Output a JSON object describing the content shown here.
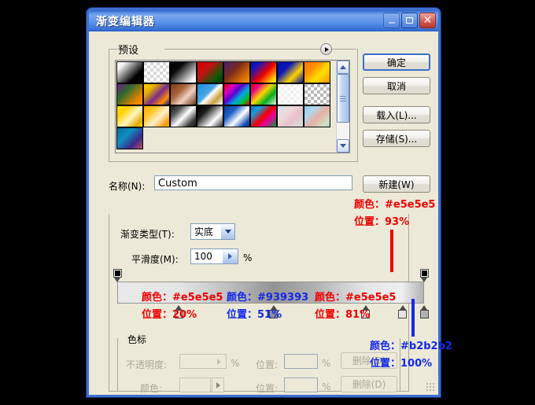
{
  "window": {
    "title": "渐变编辑器",
    "controls": {
      "minimize": "minimize",
      "maximize": "maximize",
      "close": "close"
    }
  },
  "presets": {
    "label": "预设",
    "menu_icon": "play-arrow-icon",
    "swatches": [
      [
        "linear-gradient(135deg,#ffffff 0%,#f2f2f2 18%,#000000 72%,#000000 100%)",
        "repeating-conic-gradient(#ffffff 0% 25%,#d8d8d8 0% 50%) 0 0/8px 8px",
        "linear-gradient(135deg,#000000 0%,#0a0a0a 30%,#ffffff 88%,#ffffff 100%)",
        "linear-gradient(135deg,#d40000 0%,#c81010 35%,#0a5a0a 75%,#063806 100%)",
        "linear-gradient(135deg,#4b1f6e 0%,#7a2a20 40%,#e07000 78%,#ff9000 100%)",
        "linear-gradient(135deg,#0012a8 0%,#1515c0 20%,#ee0000 55%,#ffd400 88%,#ffe000 100%)",
        "linear-gradient(135deg,#0012a8 0%,#0b18b8 32%,#ffd400 66%,#0012a8 100%)",
        "linear-gradient(135deg,#ff7a00 0%,#ff8c00 30%,#ffe000 62%,#ff9000 100%)"
      ],
      [
        "linear-gradient(135deg,#6b1f7a 0%,#2f6b2f 35%,#e08000 75%,#ff9500 100%)",
        "linear-gradient(135deg,#ffd400 0%,#e8b000 25%,#7a2a8a 55%,#ff9000 80%,#0a1a8a 100%)",
        "linear-gradient(135deg,#7a3a1a 0%,#a8643a 35%,#f0d0c0 62%,#6b3418 100%)",
        "linear-gradient(135deg,#1f8ad4 0%,#4aa8e8 42%,#ffffff 52%,#c8a040 75%,#ffffff 100%)",
        "linear-gradient(135deg,#ee0000 0%,#e000c0 22%,#5a00d0 42%,#00a8e0 62%,#00c030 82%,#ee0000 100%)",
        "linear-gradient(135deg,#ee0000 0%,#e8008a 20%,#ffd400 45%,#00b020 70%,rgba(255,255,255,0.15) 100%)",
        "repeating-conic-gradient(#ffffff 0% 25%,#eeeeee 0% 50%) 0 0/8px 8px",
        "repeating-conic-gradient(#ffffff 0% 25%,#b8b8b8 0% 50%) 0 0/8px 8px"
      ],
      [
        "linear-gradient(135deg,#ffe000 0%,#ffd000 25%,#fff6c0 55%,#e0a800 85%,#ffe800 100%)",
        "linear-gradient(135deg,#ffb000 0%,#ffc830 30%,#fff0d0 58%,#ff9800 88%,#ffb400 100%)",
        "linear-gradient(135deg,#1a1a1a 0%,#555555 25%,#ffffff 52%,#444444 80%,#111111 100%)",
        "linear-gradient(135deg,#000000 0%,#1a1a1a 28%,#ffffff 68%,#2a2a2a 100%)",
        "linear-gradient(135deg,#0a3a9a 0%,#2060c8 30%,#ffffff 58%,#1a4fb8 85%,#0a2f8a 100%)",
        "linear-gradient(135deg,#0a70c8 0%,#10a0e0 22%,#ee0000 50%,#e800a0 70%,#00a030 100%)",
        "linear-gradient(135deg,#cfe6f5 0%,#f0d8d8 35%,#e8c0c8 62%,#cfe8d8 100%)",
        "linear-gradient(135deg,#8ec8ea 0%,#b0d8f0 25%,#e8b0a0 55%,#cfe0c8 85%,#9ed8c0 100%)"
      ],
      [
        "linear-gradient(135deg,#0a6a9a 0%,#1090c0 35%,#3a2a8a 70%,#c04a6a 100%)"
      ]
    ],
    "scrollbar": {
      "up_icon": "chevron-up-icon",
      "down_icon": "chevron-down-icon",
      "thumb_grip_icon": "grip-lines-icon"
    }
  },
  "name_row": {
    "label": "名称(N):",
    "value": "Custom"
  },
  "gradient_type": {
    "label": "渐变类型(T):",
    "value": "实底",
    "dropdown_icon": "chevron-down-icon"
  },
  "smoothness": {
    "label": "平滑度(M):",
    "value": "100",
    "unit": "%",
    "arrow_icon": "play-arrow-icon"
  },
  "gradient_bar": {
    "css": "linear-gradient(to right,#e9e9e9 0%,#e5e5e5 20%,#c0c0c0 36%,#939393 51%,#b0b0b0 64%,#e5e5e5 81%,#efefef 93%,#b2b2b2 100%)",
    "opacity_stops": [
      {
        "position": 0,
        "value": "100%"
      },
      {
        "position": 100,
        "value": "100%"
      }
    ],
    "color_stops": [
      {
        "position": 20,
        "color": "#e5e5e5"
      },
      {
        "position": 51,
        "color": "#939393"
      },
      {
        "position": 81,
        "color": "#e5e5e5"
      },
      {
        "position": 93,
        "color": "#e5e5e5"
      },
      {
        "position": 100,
        "color": "#b2b2b2"
      }
    ]
  },
  "stops_group": {
    "label": "色标",
    "opacity_label": "不透明度:",
    "opacity_value": "",
    "opacity_unit": "%",
    "opacity_arrow_icon": "play-arrow-icon",
    "location_label_1": "位置:",
    "location_value_1": "",
    "location_unit_1": "%",
    "delete_label_1": "删除(D)",
    "color_label": "颜色:",
    "color_value": "",
    "color_arrow_icon": "play-arrow-icon",
    "location_label_2": "位置:",
    "location_value_2": "",
    "location_unit_2": "%",
    "delete_label_2": "删除(D)"
  },
  "buttons": {
    "ok": "确定",
    "cancel": "取消",
    "load": "载入(L)...",
    "save": "存储(S)...",
    "new": "新建(W)"
  },
  "annotations": [
    {
      "id": "a93",
      "color_line": "颜色：#e5e5e5",
      "pos_line": "位置：93%",
      "tone": "red"
    },
    {
      "id": "a20",
      "color_line": "颜色：#e5e5e5",
      "pos_line": "位置：20%",
      "tone": "red"
    },
    {
      "id": "a51",
      "color_line": "颜色：#939393",
      "pos_line": "位置：51%",
      "tone": "blue"
    },
    {
      "id": "a81",
      "color_line": "颜色：#e5e5e5",
      "pos_line": "位置：81%",
      "tone": "red"
    },
    {
      "id": "a100",
      "color_line": "颜色：#b2b2b2",
      "pos_line": "位置：100%",
      "tone": "blue"
    }
  ],
  "colors": {
    "accent": "#3f6fd1",
    "face": "#ece9d8",
    "anno_red": "#ee0000",
    "anno_blue": "#1528e8"
  }
}
